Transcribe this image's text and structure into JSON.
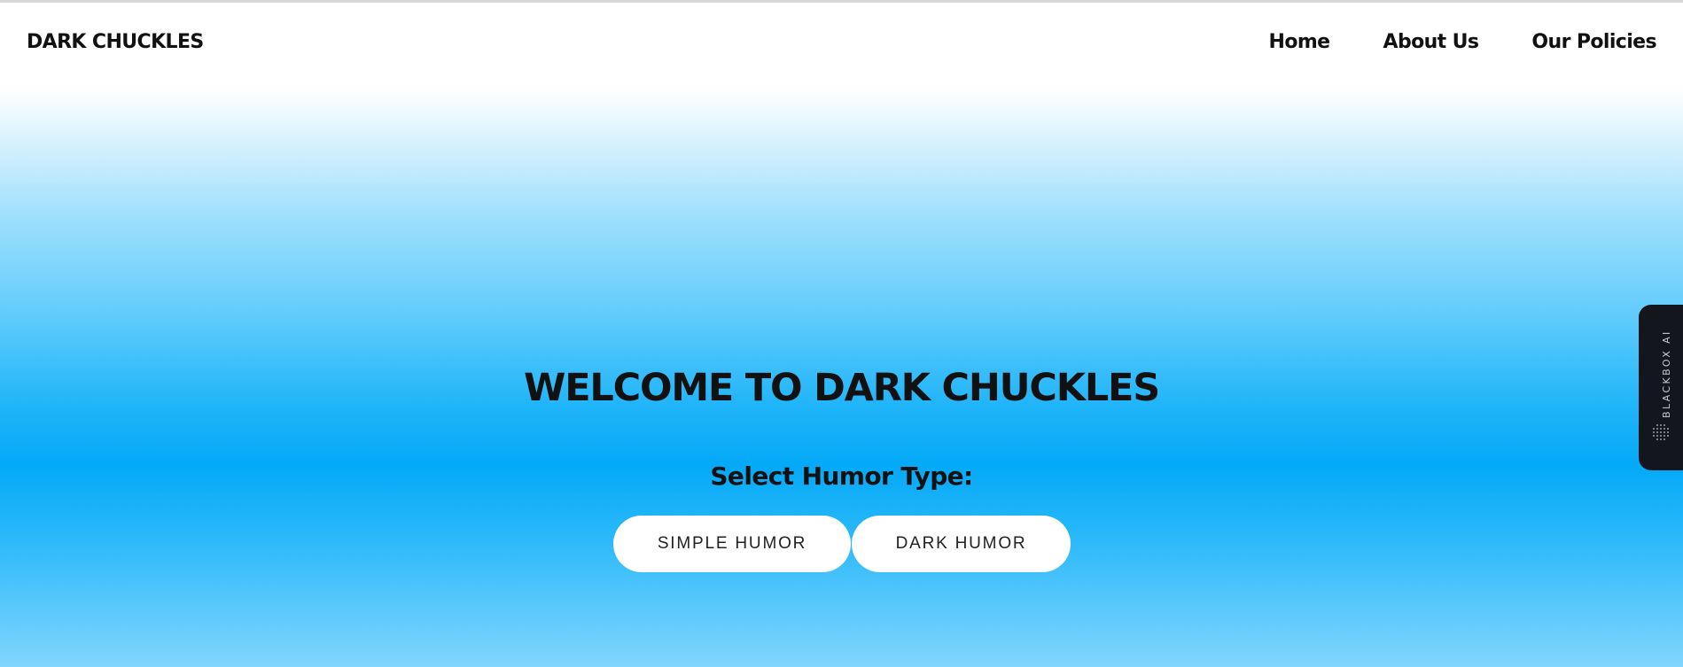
{
  "header": {
    "brand": "DARK CHUCKLES",
    "nav": [
      {
        "label": "Home"
      },
      {
        "label": "About Us"
      },
      {
        "label": "Our Policies"
      }
    ]
  },
  "hero": {
    "title": "WELCOME TO DARK CHUCKLES",
    "subtitle": "Select Humor Type:",
    "buttons": {
      "simple": "SIMPLE HUMOR",
      "dark": "DARK HUMOR"
    }
  },
  "side_widget": {
    "label": "BLACKBOX AI",
    "icon": "dotted-sphere-icon"
  },
  "colors": {
    "gradient_top": "#ffffff",
    "gradient_mid": "#04a9f7",
    "gradient_bottom": "#80d5fc",
    "text": "#111111",
    "button_bg": "#ffffff",
    "widget_bg": "#14161e"
  }
}
